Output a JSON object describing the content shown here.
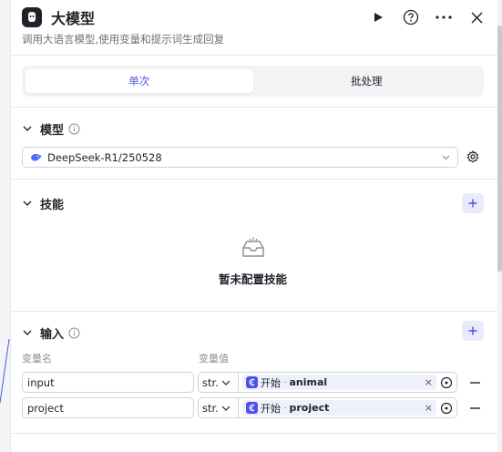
{
  "header": {
    "title": "大模型",
    "subtitle": "调用大语言模型,使用变量和提示词生成回复",
    "icons": [
      "app-logo",
      "play-icon",
      "help-icon",
      "more-icon",
      "close-icon"
    ]
  },
  "mode_tabs": [
    {
      "label": "单次",
      "active": true
    },
    {
      "label": "批处理",
      "active": false
    }
  ],
  "model_section": {
    "title": "模型",
    "selected_model": "DeepSeek-R1/250528"
  },
  "skills_section": {
    "title": "技能",
    "empty_text": "暂未配置技能"
  },
  "input_section": {
    "title": "输入",
    "col_name": "变量名",
    "col_value": "变量值",
    "rows": [
      {
        "name": "input",
        "type": "str.",
        "node": "开始",
        "var": "animal"
      },
      {
        "name": "project",
        "type": "str.",
        "node": "开始",
        "var": "project"
      }
    ]
  },
  "colors": {
    "accent": "#4d53e8",
    "accent_light": "#e9eafc",
    "border": "#d0d3d9",
    "text": "#1f2329"
  }
}
